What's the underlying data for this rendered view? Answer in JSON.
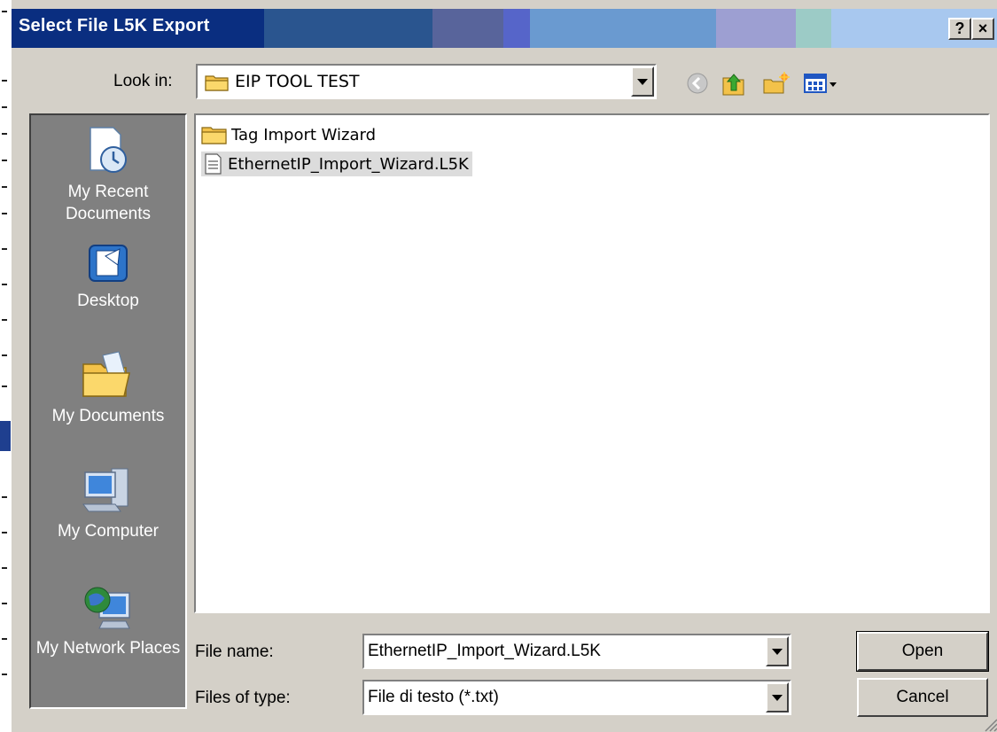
{
  "window": {
    "title": "Select File L5K Export",
    "help_label": "?",
    "close_label": "×"
  },
  "look_in": {
    "label": "Look in:",
    "value": "EIP TOOL TEST"
  },
  "places": [
    {
      "label": "My Recent Documents",
      "icon": "recent-documents-icon"
    },
    {
      "label": "Desktop",
      "icon": "desktop-icon"
    },
    {
      "label": "My Documents",
      "icon": "my-documents-icon"
    },
    {
      "label": "My Computer",
      "icon": "my-computer-icon"
    },
    {
      "label": "My Network Places",
      "icon": "network-places-icon"
    }
  ],
  "files": [
    {
      "name": "Tag Import Wizard",
      "type": "folder"
    },
    {
      "name": "EthernetIP_Import_Wizard.L5K",
      "type": "file",
      "selected": true
    }
  ],
  "file_name": {
    "label": "File name:",
    "value": "EthernetIP_Import_Wizard.L5K"
  },
  "file_type": {
    "label": "Files of type:",
    "value": "File di testo (*.txt)"
  },
  "buttons": {
    "open": "Open",
    "cancel": "Cancel"
  }
}
